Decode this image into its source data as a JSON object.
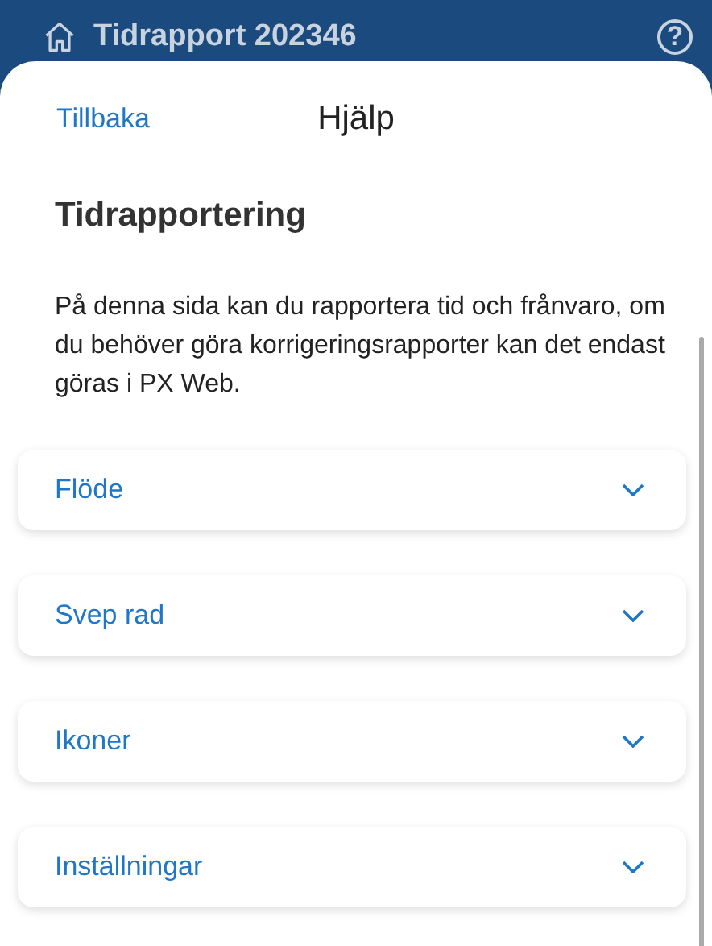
{
  "app_bar": {
    "title": "Tidrapport 202346",
    "help_glyph": "?"
  },
  "sheet": {
    "back_link": "Tillbaka",
    "title": "Hjälp"
  },
  "help": {
    "heading": "Tidrapportering",
    "text": "På denna sida kan du rapportera tid och frånvaro, om du behöver göra korrigeringsrapporter kan det endast göras i PX Web."
  },
  "sections": [
    {
      "label": "Flöde",
      "expanded": false
    },
    {
      "label": "Svep rad",
      "expanded": false
    },
    {
      "label": "Ikoner",
      "expanded": false
    },
    {
      "label": "Inställningar",
      "expanded": false
    }
  ]
}
